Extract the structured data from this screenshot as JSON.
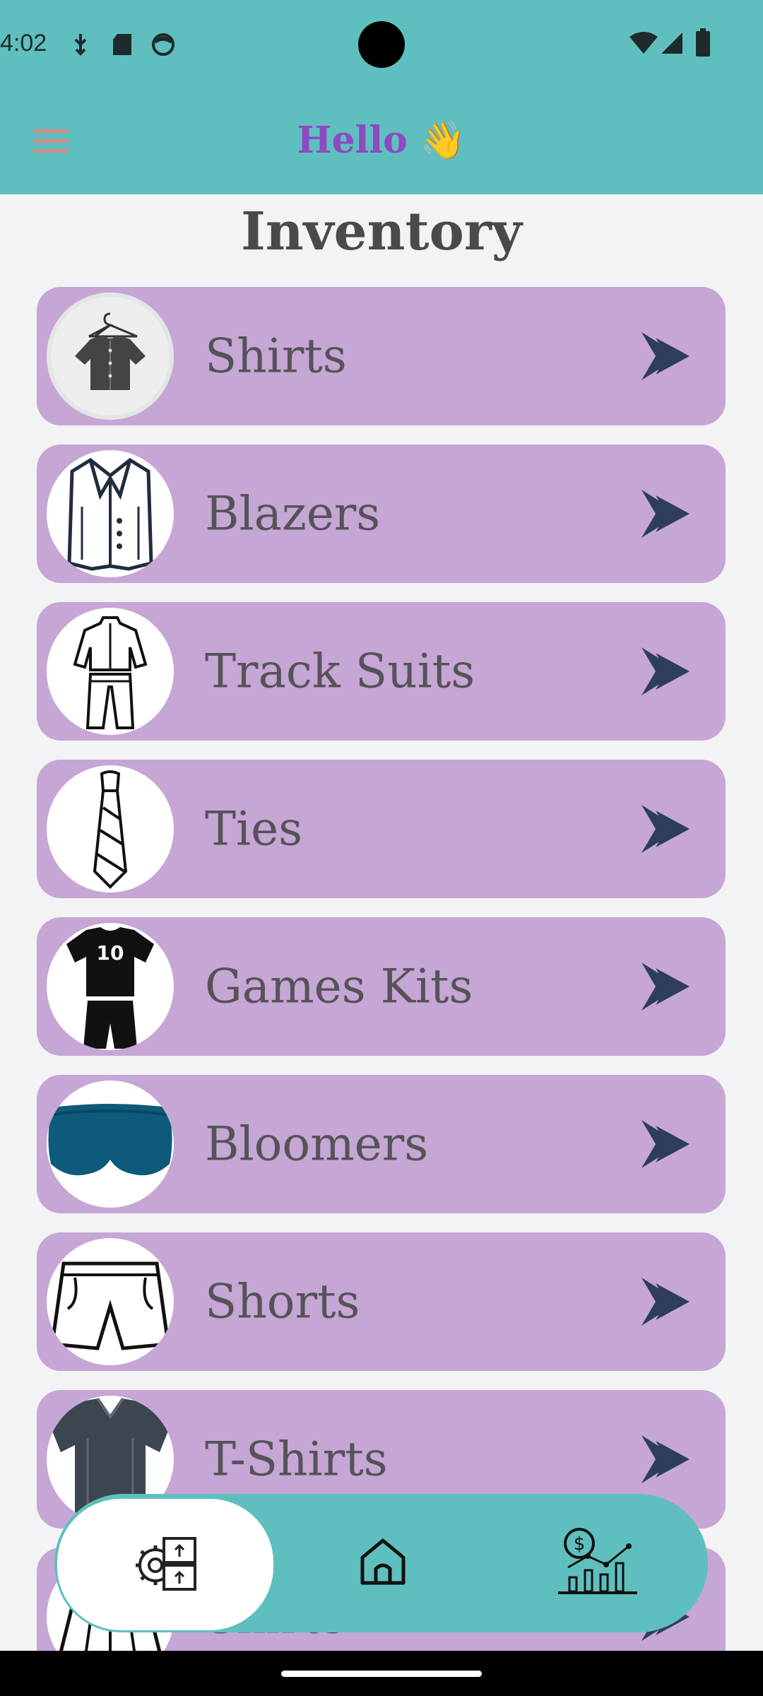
{
  "status_bar": {
    "time": "4:02",
    "left_icons": [
      "usb-debug-icon",
      "sd-card-icon",
      "face-icon"
    ],
    "right_icons": [
      "wifi-icon",
      "cell-signal-icon",
      "battery-icon"
    ]
  },
  "header": {
    "menu_icon": "hamburger-menu-icon",
    "greeting_text": "Hello",
    "greeting_emoji": "👋",
    "background_color": "#5fbfbf",
    "greeting_color": "#8e4ac0"
  },
  "page": {
    "title": "Inventory"
  },
  "inventory": {
    "card_color": "#c6a6d4",
    "chevron_icon": "double-chevron-right-icon",
    "items": [
      {
        "label": "Shirts",
        "icon": "shirt-on-hanger-icon"
      },
      {
        "label": "Blazers",
        "icon": "blazer-icon"
      },
      {
        "label": "Track Suits",
        "icon": "track-suit-icon"
      },
      {
        "label": "Ties",
        "icon": "tie-icon"
      },
      {
        "label": "Games Kits",
        "icon": "games-kit-icon",
        "jersey_number": "10"
      },
      {
        "label": "Bloomers",
        "icon": "bloomers-icon"
      },
      {
        "label": "Shorts",
        "icon": "shorts-icon"
      },
      {
        "label": "T-Shirts",
        "icon": "t-shirt-icon"
      },
      {
        "label": "Skirts",
        "icon": "skirt-icon"
      }
    ]
  },
  "bottom_nav": {
    "items": [
      {
        "icon": "inventory-settings-icon",
        "active": true
      },
      {
        "icon": "home-icon",
        "active": false
      },
      {
        "icon": "sales-chart-icon",
        "active": false
      }
    ]
  }
}
